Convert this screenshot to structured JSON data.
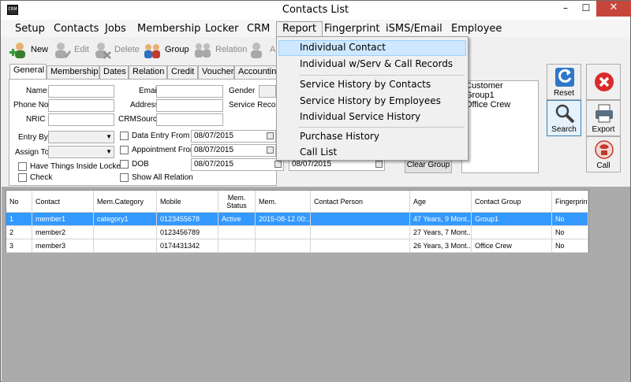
{
  "window": {
    "title": "Contacts List",
    "app_icon_text": "CRM",
    "min": "–",
    "max": "☐",
    "close": "✕"
  },
  "menu": [
    "Setup",
    "Contacts",
    "Jobs",
    "Membership",
    "Locker",
    "CRM",
    "Report",
    "Fingerprint",
    "iSMS/Email",
    "Employee"
  ],
  "toolbar": {
    "new": "New",
    "edit": "Edit",
    "delete": "Delete",
    "group": "Group",
    "relation": "Relation",
    "a": "A"
  },
  "tabs": [
    "General",
    "Membership",
    "Dates",
    "Relation",
    "Credit",
    "Voucher",
    "Accountin"
  ],
  "form": {
    "name": "Name",
    "phone": "Phone No",
    "nric": "NRIC",
    "email": "Email",
    "address": "Address",
    "crm_source": "CRMSource",
    "gender": "Gender",
    "service_record": "Service Record",
    "entry_by": "Entry By",
    "assign_to": "Assign To",
    "have_things": "Have Things Inside Locker",
    "check": "Check",
    "data_entry_from": "Data Entry From",
    "appointment_from": "Appointment From",
    "dob": "DOB",
    "show_all_relation": "Show All Relation",
    "date1": "08/07/2015",
    "date2": "08/07/2015",
    "date3": "08/07/2015",
    "date4": "08/07/2015"
  },
  "groups": [
    "Customer",
    "Group1",
    "Office Crew"
  ],
  "buttons": {
    "clear_group": "Clear Group",
    "reset": "Reset",
    "search": "Search",
    "export": "Export",
    "call": "Call"
  },
  "report_menu": {
    "items": [
      "Individual Contact",
      "Individual w/Serv & Call Records",
      "Service History by Contacts",
      "Service History by Employees",
      "Individual Service History",
      "Purchase History",
      "Call List"
    ]
  },
  "table": {
    "headers": [
      "No",
      "Contact",
      "Mem.Category",
      "Mobile",
      "Mem. Status",
      "Mem.",
      "Contact Person",
      "Age",
      "Contact Group",
      "Fingerprint"
    ],
    "rows": [
      [
        "1",
        "member1",
        "category1",
        "0123455678",
        "Active",
        "2015-08-12 00:...",
        "",
        "47 Years, 9 Mont...",
        "Group1",
        "No"
      ],
      [
        "2",
        "member2",
        "",
        "0123456789",
        "",
        "",
        "",
        "27 Years, 7 Mont...",
        "",
        "No"
      ],
      [
        "3",
        "member3",
        "",
        "0174431342",
        "",
        "",
        "",
        "26 Years, 3 Mont...",
        "Office Crew",
        "No"
      ]
    ]
  },
  "colors": {
    "selection": "#3399FF",
    "menu_highlight": "#CDE8FF",
    "close_button": "#C7463B"
  }
}
